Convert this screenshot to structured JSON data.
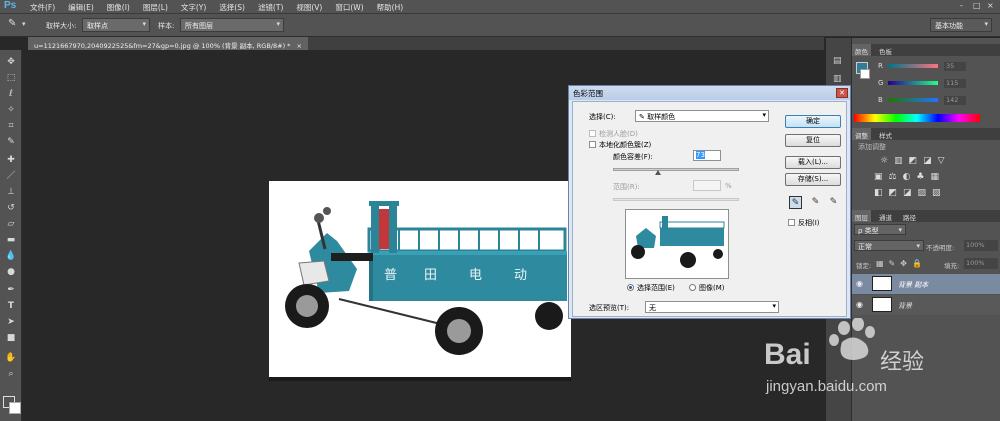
{
  "app": {
    "logo": "Ps"
  },
  "menu": [
    "文件(F)",
    "编辑(E)",
    "图像(I)",
    "图层(L)",
    "文字(Y)",
    "选择(S)",
    "滤镜(T)",
    "视图(V)",
    "窗口(W)",
    "帮助(H)"
  ],
  "window_controls": {
    "minimize": "-",
    "restore": "□",
    "close": "×"
  },
  "options": {
    "sample_size_label": "取样大小:",
    "sample_size_value": "取样点",
    "sample_label": "样本:",
    "sample_value": "所有图层",
    "workspace": "基本功能"
  },
  "document": {
    "tab_title": "u=1121667970,2040922525&fm=27&gp=0.jpg @ 100% (背景 副本, RGB/8#) *",
    "tab_close": "×"
  },
  "tools": [
    "move",
    "marquee",
    "lasso",
    "quick-select",
    "crop",
    "eyedropper",
    "healing",
    "brush",
    "stamp",
    "history-brush",
    "eraser",
    "gradient",
    "blur",
    "dodge",
    "pen",
    "type",
    "path-select",
    "shape",
    "hand",
    "zoom"
  ],
  "colors": {
    "foreground": "#2f7d97",
    "accent": "#5fb4e8",
    "truck": "#2e8a9e"
  },
  "color_panel": {
    "tabs": [
      "颜色",
      "色板"
    ],
    "channels": [
      {
        "name": "R",
        "value": "35"
      },
      {
        "name": "G",
        "value": "115"
      },
      {
        "name": "B",
        "value": "142"
      }
    ]
  },
  "adjust_panel": {
    "tabs": [
      "调整",
      "样式"
    ],
    "title": "添加调整"
  },
  "layers_panel": {
    "tabs": [
      "图层",
      "通道",
      "路径"
    ],
    "filter": "ρ 类型",
    "blend_mode": "正常",
    "opacity_label": "不透明度:",
    "opacity": "100%",
    "lock_label": "锁定:",
    "fill_label": "填充:",
    "fill": "100%",
    "layers": [
      {
        "name": "背景 副本",
        "active": true
      },
      {
        "name": "背景",
        "active": false
      }
    ]
  },
  "dialog": {
    "title": "色彩范围",
    "select_label": "选择(C):",
    "select_value": "取样颜色",
    "detect_faces": "检测人脸(D)",
    "localized": "本地化颜色簇(Z)",
    "fuzziness_label": "颜色容差(F):",
    "fuzziness_value": "73",
    "fuzziness_fraction": 0.36,
    "range_label": "范围(R):",
    "range_unit": "%",
    "radio_selection": "选择范围(E)",
    "radio_image": "图像(M)",
    "preview_label": "选区预览(T):",
    "preview_value": "无",
    "ok": "确定",
    "reset": "复位",
    "load": "载入(L)...",
    "save": "存储(S)...",
    "invert": "反相(I)"
  },
  "watermark": {
    "brand": "Bai",
    "brand2": "经验",
    "url": "jingyan.baidu.com"
  }
}
